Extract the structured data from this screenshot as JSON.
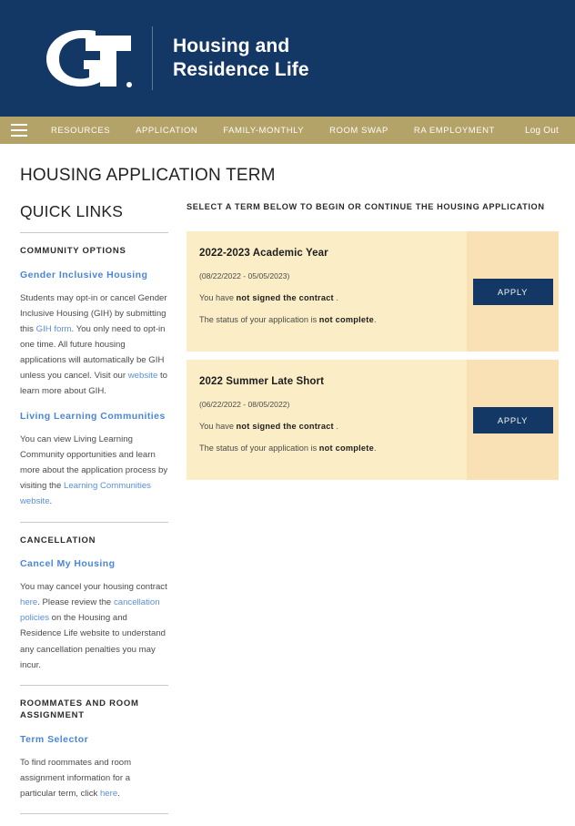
{
  "header": {
    "logo_name": "georgia-tech-gt-logo",
    "title": "Housing and\nResidence Life",
    "bg_color": "#143865"
  },
  "nav": {
    "menu_icon": "hamburger-menu-icon",
    "bg_color": "#b3a369",
    "items": [
      {
        "label": "RESOURCES"
      },
      {
        "label": "APPLICATION"
      },
      {
        "label": "FAMILY-MONTHLY"
      },
      {
        "label": "ROOM SWAP"
      },
      {
        "label": "RA EMPLOYMENT"
      }
    ],
    "logout_label": "Log Out"
  },
  "page": {
    "title": "HOUSING APPLICATION TERM"
  },
  "sidebar": {
    "title": "QUICK LINKS",
    "sections": [
      {
        "heading": "COMMUNITY OPTIONS",
        "entries": [
          {
            "link": "Gender Inclusive Housing",
            "body_parts": [
              {
                "t": "Students may opt-in or cancel Gender Inclusive Housing (GIH) by submitting this ",
                "link": false
              },
              {
                "t": "GIH form",
                "link": true
              },
              {
                "t": ". You only need to opt-in one time. All future housing applications will automatically be GIH unless you cancel. Visit our ",
                "link": false
              },
              {
                "t": "website",
                "link": true
              },
              {
                "t": " to learn more about GIH.",
                "link": false
              }
            ]
          },
          {
            "link": "Living Learning Communities",
            "body_parts": [
              {
                "t": "You can view Living Learning Community opportunities and learn more about the application process by visiting the ",
                "link": false
              },
              {
                "t": "Learning Communities website",
                "link": true
              },
              {
                "t": ".",
                "link": false
              }
            ]
          }
        ]
      },
      {
        "heading": "CANCELLATION",
        "entries": [
          {
            "link": "Cancel My Housing",
            "body_parts": [
              {
                "t": "You may cancel your housing contract ",
                "link": false
              },
              {
                "t": "here",
                "link": true
              },
              {
                "t": ". Please review the ",
                "link": false
              },
              {
                "t": "cancellation policies",
                "link": true
              },
              {
                "t": " on the Housing and Residence Life website to understand any cancellation penalties you may incur.",
                "link": false
              }
            ]
          }
        ]
      },
      {
        "heading": "ROOMMATES AND ROOM ASSIGNMENT",
        "entries": [
          {
            "link": "Term Selector",
            "body_parts": [
              {
                "t": "To find roommates and room assignment information for a particular term, click ",
                "link": false
              },
              {
                "t": "here",
                "link": true
              },
              {
                "t": ".",
                "link": false
              }
            ]
          }
        ]
      }
    ]
  },
  "main": {
    "instruction": "SELECT A TERM BELOW TO BEGIN OR CONTINUE THE HOUSING APPLICATION",
    "card_bg": "#fbeec7",
    "card_action_bg": "#fae0b5",
    "apply_bg": "#143865",
    "terms": [
      {
        "name": "2022-2023 Academic Year",
        "dates": "(08/22/2022 - 05/05/2023)",
        "contract_prefix": "You have ",
        "contract_status": "not signed the contract",
        "contract_suffix": " .",
        "app_prefix": "The status of your application is ",
        "app_status": "not complete",
        "app_suffix": ".",
        "apply_label": "APPLY"
      },
      {
        "name": "2022 Summer Late Short",
        "dates": "(06/22/2022 - 08/05/2022)",
        "contract_prefix": "You have ",
        "contract_status": "not signed the contract",
        "contract_suffix": " .",
        "app_prefix": "The status of your application is ",
        "app_status": "not complete",
        "app_suffix": ".",
        "apply_label": "APPLY"
      }
    ]
  }
}
